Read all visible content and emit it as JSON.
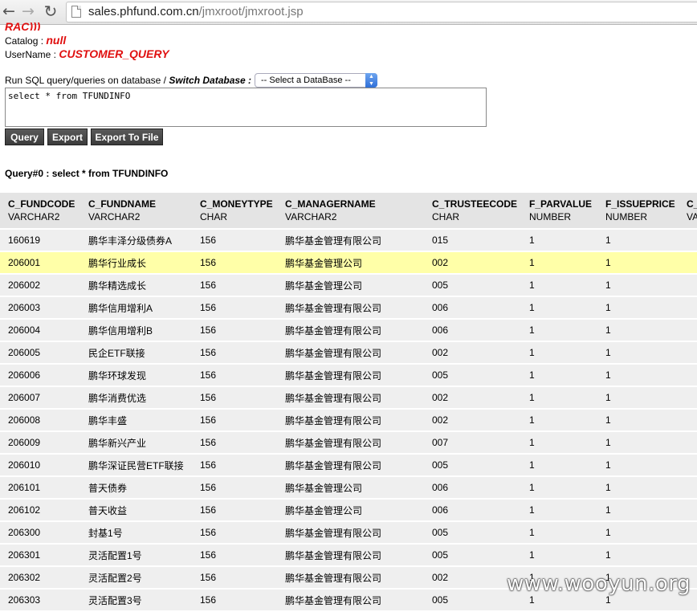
{
  "browser": {
    "back_glyph": "←",
    "forward_glyph": "→",
    "reload_glyph": "↻",
    "url_domain": "sales.phfund.com.cn",
    "url_path": "/jmxroot/jmxroot.jsp"
  },
  "header": {
    "rac_text": "RAC)))",
    "catalog_label": "Catalog : ",
    "catalog_value": "null",
    "username_label": "UserName : ",
    "username_value": "CUSTOMER_QUERY"
  },
  "query_form": {
    "run_label": "Run SQL query/queries on database / ",
    "switch_label": "Switch Database :",
    "db_select_value": "-- Select a DataBase --",
    "sql_text": "select * from TFUNDINFO",
    "query_button": "Query",
    "export_button": "Export",
    "export_file_button": "Export To File"
  },
  "result": {
    "heading": "Query#0 : select * from TFUNDINFO",
    "columns": [
      {
        "name": "C_FUNDCODE",
        "type": "VARCHAR2"
      },
      {
        "name": "C_FUNDNAME",
        "type": "VARCHAR2"
      },
      {
        "name": "C_MONEYTYPE",
        "type": "CHAR"
      },
      {
        "name": "C_MANAGERNAME",
        "type": "VARCHAR2"
      },
      {
        "name": "C_TRUSTEECODE",
        "type": "CHAR"
      },
      {
        "name": "F_PARVALUE",
        "type": "NUMBER"
      },
      {
        "name": "F_ISSUEPRICE",
        "type": "NUMBER"
      },
      {
        "name": "C_",
        "type": "VA"
      }
    ],
    "rows": [
      [
        "160619",
        "鹏华丰泽分级债券A",
        "156",
        "鹏华基金管理有限公司",
        "015",
        "1",
        "1",
        ""
      ],
      [
        "206001",
        "鹏华行业成长",
        "156",
        "鹏华基金管理公司",
        "002",
        "1",
        "1",
        ""
      ],
      [
        "206002",
        "鹏华精选成长",
        "156",
        "鹏华基金管理公司",
        "005",
        "1",
        "1",
        ""
      ],
      [
        "206003",
        "鹏华信用增利A",
        "156",
        "鹏华基金管理有限公司",
        "006",
        "1",
        "1",
        ""
      ],
      [
        "206004",
        "鹏华信用增利B",
        "156",
        "鹏华基金管理有限公司",
        "006",
        "1",
        "1",
        ""
      ],
      [
        "206005",
        "民企ETF联接",
        "156",
        "鹏华基金管理有限公司",
        "002",
        "1",
        "1",
        ""
      ],
      [
        "206006",
        "鹏华环球发现",
        "156",
        "鹏华基金管理有限公司",
        "005",
        "1",
        "1",
        ""
      ],
      [
        "206007",
        "鹏华消费优选",
        "156",
        "鹏华基金管理有限公司",
        "002",
        "1",
        "1",
        ""
      ],
      [
        "206008",
        "鹏华丰盛",
        "156",
        "鹏华基金管理有限公司",
        "002",
        "1",
        "1",
        ""
      ],
      [
        "206009",
        "鹏华新兴产业",
        "156",
        "鹏华基金管理有限公司",
        "007",
        "1",
        "1",
        ""
      ],
      [
        "206010",
        "鹏华深证民营ETF联接",
        "156",
        "鹏华基金管理有限公司",
        "005",
        "1",
        "1",
        ""
      ],
      [
        "206101",
        "普天债券",
        "156",
        "鹏华基金管理公司",
        "006",
        "1",
        "1",
        ""
      ],
      [
        "206102",
        "普天收益",
        "156",
        "鹏华基金管理公司",
        "006",
        "1",
        "1",
        ""
      ],
      [
        "206300",
        "封基1号",
        "156",
        "鹏华基金管理有限公司",
        "005",
        "1",
        "1",
        ""
      ],
      [
        "206301",
        "灵活配置1号",
        "156",
        "鹏华基金管理有限公司",
        "005",
        "1",
        "1",
        ""
      ],
      [
        "206302",
        "灵活配置2号",
        "156",
        "鹏华基金管理有限公司",
        "002",
        "1",
        "1",
        ""
      ],
      [
        "206303",
        "灵活配置3号",
        "156",
        "鹏华基金管理有限公司",
        "005",
        "1",
        "1",
        ""
      ]
    ],
    "highlighted_row": 1
  },
  "watermark": "www.wooyun.org"
}
